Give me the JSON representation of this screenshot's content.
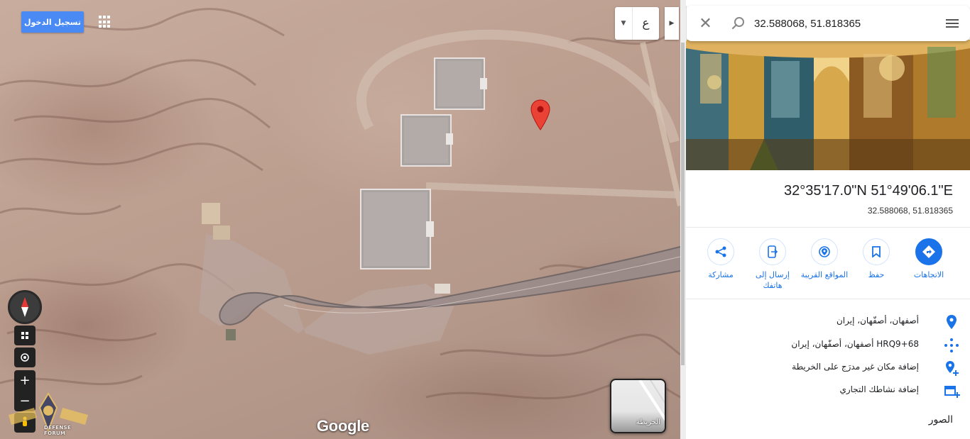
{
  "map": {
    "signin_label": "تسجيل الدخول",
    "language_label": "ع",
    "google_logo": "Google",
    "minimap_label": "الخريطة",
    "watermark_text": "DEFENSE FORUM"
  },
  "search": {
    "value": "32.588068, 51.818365"
  },
  "place": {
    "coordinates_dms": "32°35'17.0\"N 51°49'06.1\"E",
    "coordinates_decimal": "32.588068, 51.818365"
  },
  "actions": [
    {
      "label": "الاتجاهات",
      "icon": "directions-icon"
    },
    {
      "label": "حفظ",
      "icon": "bookmark-icon"
    },
    {
      "label": "المواقع القريبة",
      "icon": "nearby-icon"
    },
    {
      "label": "إرسال إلى هاتفك",
      "icon": "send-to-phone-icon"
    },
    {
      "label": "مشاركة",
      "icon": "share-icon"
    }
  ],
  "info": [
    {
      "text": "أصفهان، أصفّهان، إيران",
      "icon": "location-pin-icon"
    },
    {
      "text": "HRQ9+68 أصفهان، أصفّهان، إيران",
      "icon": "plus-code-icon"
    },
    {
      "text": "إضافة مكان غير مدرَج على الخريطة",
      "icon": "add-place-icon"
    },
    {
      "text": "إضافة نشاطك التجاري",
      "icon": "add-business-icon"
    }
  ],
  "photos_label": "الصور",
  "colors": {
    "accent": "#1a73e8",
    "signin": "#4a8af4",
    "pin": "#ea4335"
  }
}
